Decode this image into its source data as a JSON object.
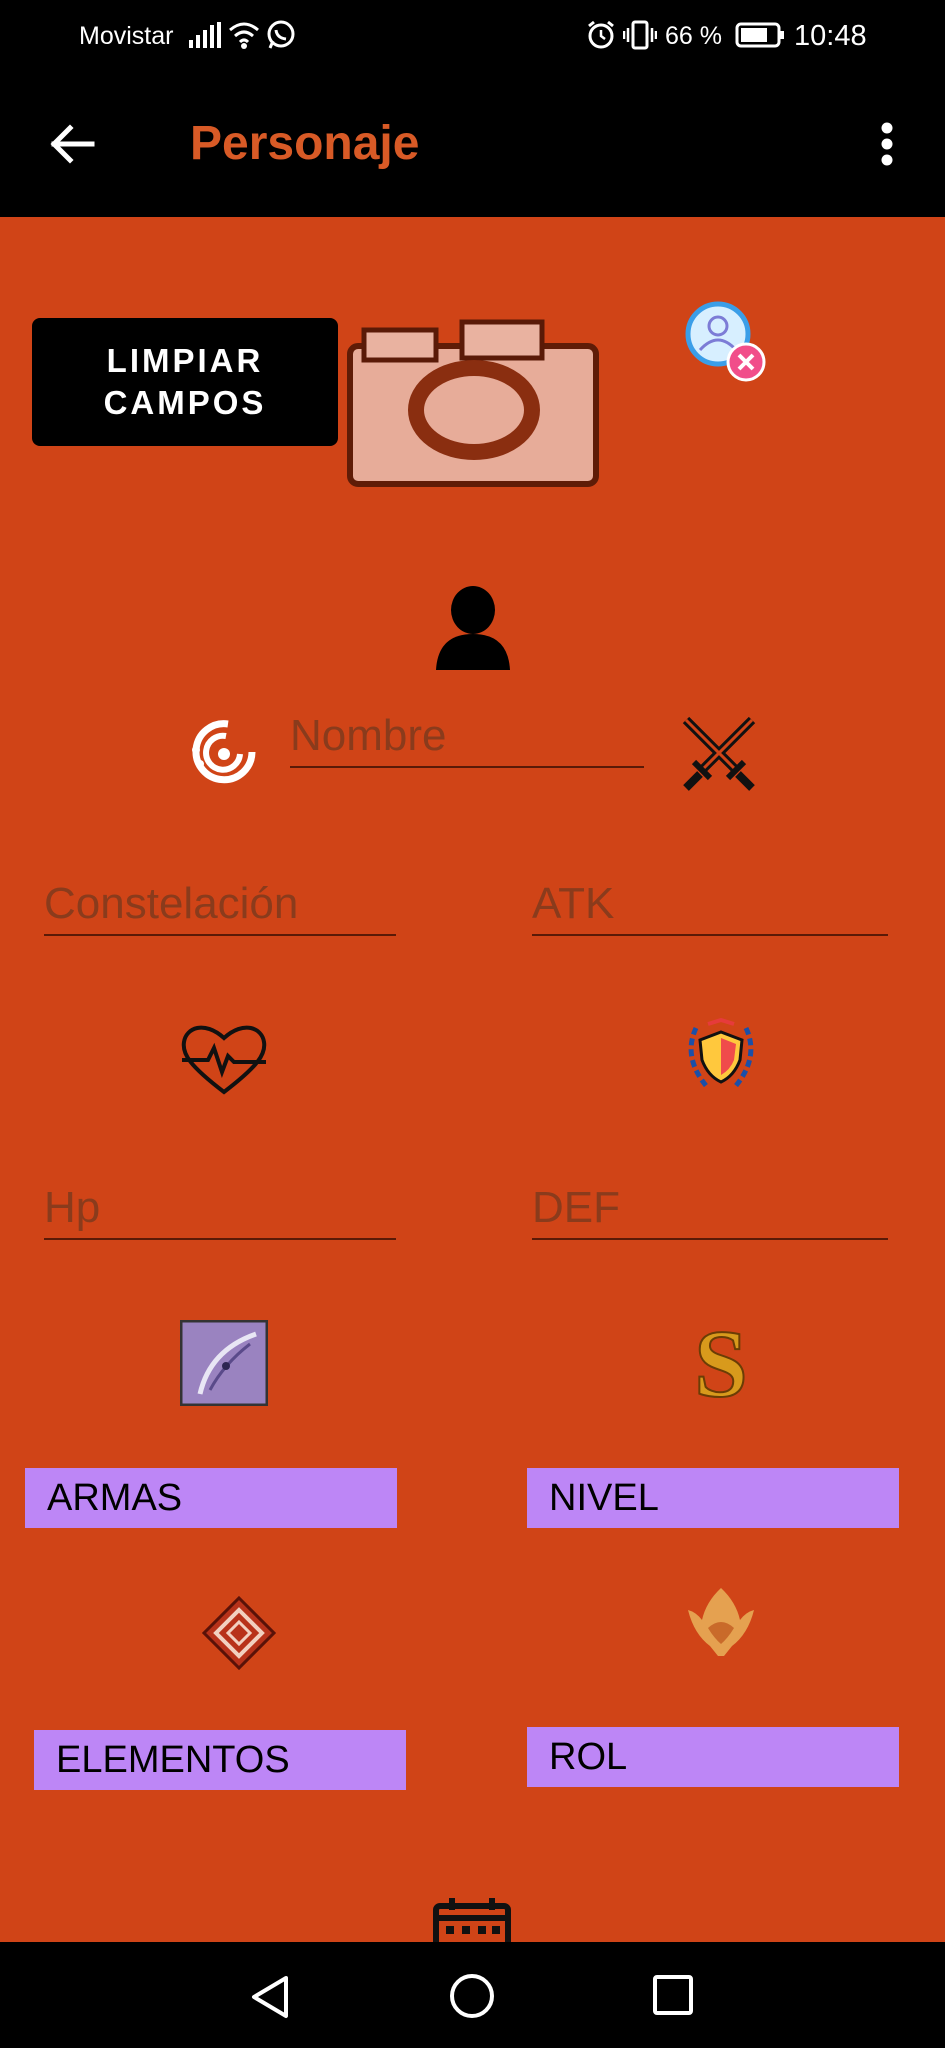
{
  "status_bar": {
    "carrier": "Movistar",
    "battery": "66 %",
    "time": "10:48"
  },
  "app_bar": {
    "title": "Personaje",
    "icons": [
      "arrow-back-icon",
      "more-vert-icon"
    ]
  },
  "actions": {
    "clear_label": "LIMPIAR\nCAMPOS"
  },
  "fields": {
    "nombre": {
      "placeholder": "Nombre",
      "value": ""
    },
    "constelacion": {
      "placeholder": "Constelación",
      "value": ""
    },
    "atk": {
      "placeholder": "ATK",
      "value": ""
    },
    "hp": {
      "placeholder": "Hp",
      "value": ""
    },
    "def": {
      "placeholder": "DEF",
      "value": ""
    }
  },
  "selectors": {
    "armas": "ARMAS",
    "nivel": "NIVEL",
    "elementos": "ELEMENTOS",
    "rol": "ROL"
  },
  "colors": {
    "background": "#d04417",
    "title": "#d85a26",
    "selector": "#bd86f6"
  }
}
